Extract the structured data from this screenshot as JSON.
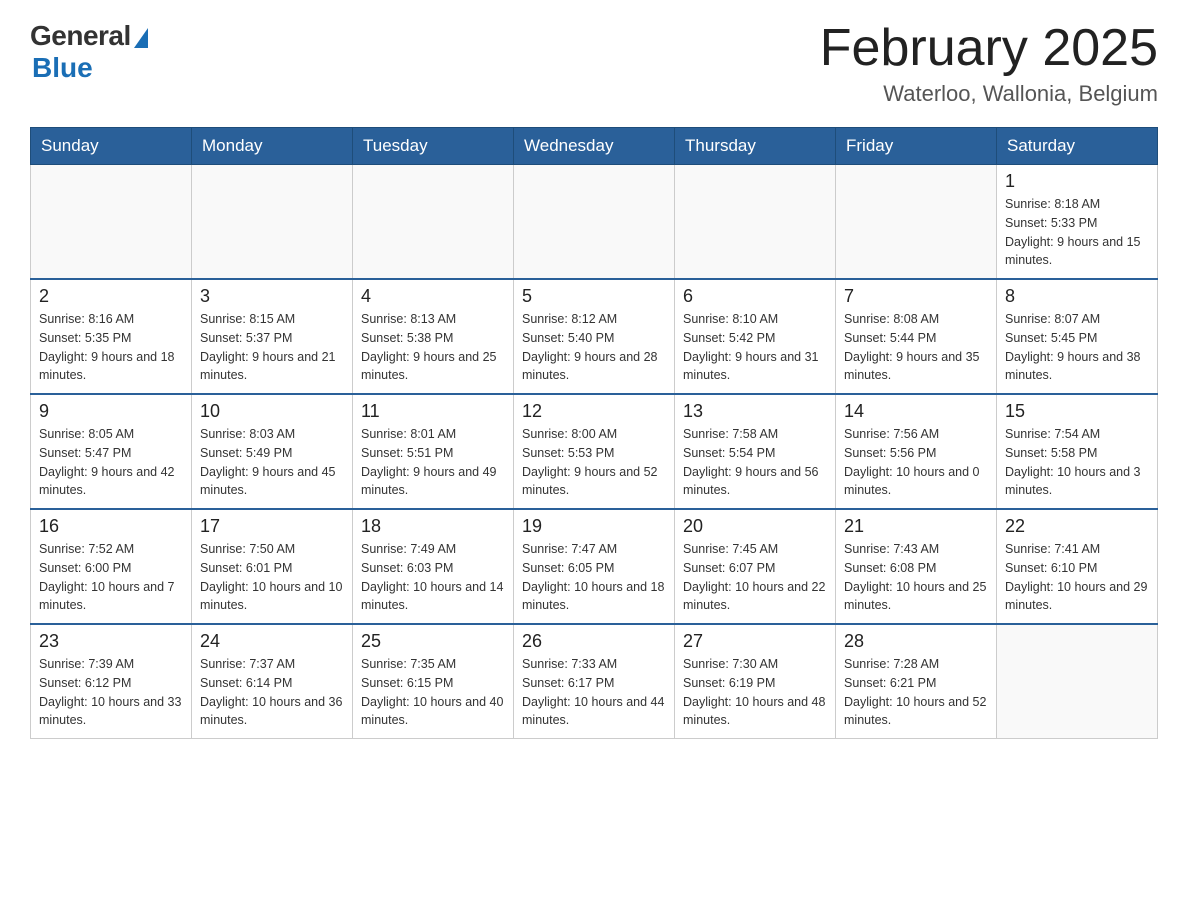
{
  "logo": {
    "general": "General",
    "blue": "Blue"
  },
  "title": "February 2025",
  "location": "Waterloo, Wallonia, Belgium",
  "weekdays": [
    "Sunday",
    "Monday",
    "Tuesday",
    "Wednesday",
    "Thursday",
    "Friday",
    "Saturday"
  ],
  "weeks": [
    [
      {
        "day": "",
        "info": ""
      },
      {
        "day": "",
        "info": ""
      },
      {
        "day": "",
        "info": ""
      },
      {
        "day": "",
        "info": ""
      },
      {
        "day": "",
        "info": ""
      },
      {
        "day": "",
        "info": ""
      },
      {
        "day": "1",
        "info": "Sunrise: 8:18 AM\nSunset: 5:33 PM\nDaylight: 9 hours and 15 minutes."
      }
    ],
    [
      {
        "day": "2",
        "info": "Sunrise: 8:16 AM\nSunset: 5:35 PM\nDaylight: 9 hours and 18 minutes."
      },
      {
        "day": "3",
        "info": "Sunrise: 8:15 AM\nSunset: 5:37 PM\nDaylight: 9 hours and 21 minutes."
      },
      {
        "day": "4",
        "info": "Sunrise: 8:13 AM\nSunset: 5:38 PM\nDaylight: 9 hours and 25 minutes."
      },
      {
        "day": "5",
        "info": "Sunrise: 8:12 AM\nSunset: 5:40 PM\nDaylight: 9 hours and 28 minutes."
      },
      {
        "day": "6",
        "info": "Sunrise: 8:10 AM\nSunset: 5:42 PM\nDaylight: 9 hours and 31 minutes."
      },
      {
        "day": "7",
        "info": "Sunrise: 8:08 AM\nSunset: 5:44 PM\nDaylight: 9 hours and 35 minutes."
      },
      {
        "day": "8",
        "info": "Sunrise: 8:07 AM\nSunset: 5:45 PM\nDaylight: 9 hours and 38 minutes."
      }
    ],
    [
      {
        "day": "9",
        "info": "Sunrise: 8:05 AM\nSunset: 5:47 PM\nDaylight: 9 hours and 42 minutes."
      },
      {
        "day": "10",
        "info": "Sunrise: 8:03 AM\nSunset: 5:49 PM\nDaylight: 9 hours and 45 minutes."
      },
      {
        "day": "11",
        "info": "Sunrise: 8:01 AM\nSunset: 5:51 PM\nDaylight: 9 hours and 49 minutes."
      },
      {
        "day": "12",
        "info": "Sunrise: 8:00 AM\nSunset: 5:53 PM\nDaylight: 9 hours and 52 minutes."
      },
      {
        "day": "13",
        "info": "Sunrise: 7:58 AM\nSunset: 5:54 PM\nDaylight: 9 hours and 56 minutes."
      },
      {
        "day": "14",
        "info": "Sunrise: 7:56 AM\nSunset: 5:56 PM\nDaylight: 10 hours and 0 minutes."
      },
      {
        "day": "15",
        "info": "Sunrise: 7:54 AM\nSunset: 5:58 PM\nDaylight: 10 hours and 3 minutes."
      }
    ],
    [
      {
        "day": "16",
        "info": "Sunrise: 7:52 AM\nSunset: 6:00 PM\nDaylight: 10 hours and 7 minutes."
      },
      {
        "day": "17",
        "info": "Sunrise: 7:50 AM\nSunset: 6:01 PM\nDaylight: 10 hours and 10 minutes."
      },
      {
        "day": "18",
        "info": "Sunrise: 7:49 AM\nSunset: 6:03 PM\nDaylight: 10 hours and 14 minutes."
      },
      {
        "day": "19",
        "info": "Sunrise: 7:47 AM\nSunset: 6:05 PM\nDaylight: 10 hours and 18 minutes."
      },
      {
        "day": "20",
        "info": "Sunrise: 7:45 AM\nSunset: 6:07 PM\nDaylight: 10 hours and 22 minutes."
      },
      {
        "day": "21",
        "info": "Sunrise: 7:43 AM\nSunset: 6:08 PM\nDaylight: 10 hours and 25 minutes."
      },
      {
        "day": "22",
        "info": "Sunrise: 7:41 AM\nSunset: 6:10 PM\nDaylight: 10 hours and 29 minutes."
      }
    ],
    [
      {
        "day": "23",
        "info": "Sunrise: 7:39 AM\nSunset: 6:12 PM\nDaylight: 10 hours and 33 minutes."
      },
      {
        "day": "24",
        "info": "Sunrise: 7:37 AM\nSunset: 6:14 PM\nDaylight: 10 hours and 36 minutes."
      },
      {
        "day": "25",
        "info": "Sunrise: 7:35 AM\nSunset: 6:15 PM\nDaylight: 10 hours and 40 minutes."
      },
      {
        "day": "26",
        "info": "Sunrise: 7:33 AM\nSunset: 6:17 PM\nDaylight: 10 hours and 44 minutes."
      },
      {
        "day": "27",
        "info": "Sunrise: 7:30 AM\nSunset: 6:19 PM\nDaylight: 10 hours and 48 minutes."
      },
      {
        "day": "28",
        "info": "Sunrise: 7:28 AM\nSunset: 6:21 PM\nDaylight: 10 hours and 52 minutes."
      },
      {
        "day": "",
        "info": ""
      }
    ]
  ]
}
